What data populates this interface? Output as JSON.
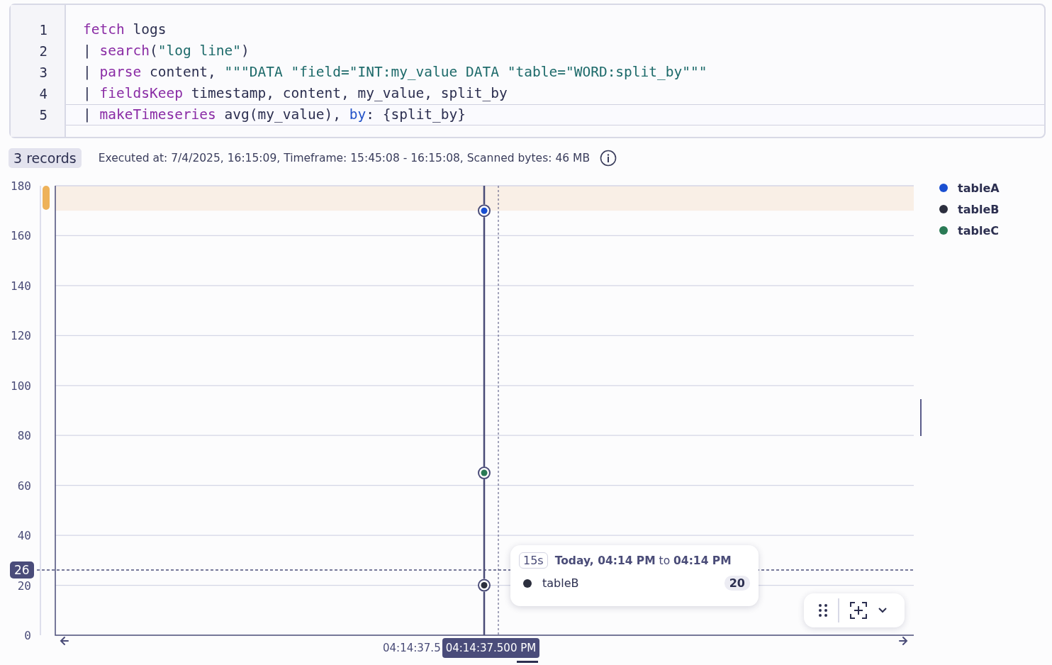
{
  "editor": {
    "lines": [
      {
        "number": "1",
        "current": false,
        "tokens": [
          {
            "kind": "kw",
            "text": "fetch"
          },
          {
            "kind": "plain",
            "text": " logs"
          }
        ]
      },
      {
        "number": "2",
        "current": false,
        "tokens": [
          {
            "kind": "plain",
            "text": "| "
          },
          {
            "kind": "kw",
            "text": "search"
          },
          {
            "kind": "plain",
            "text": "("
          },
          {
            "kind": "str",
            "text": "\"log line\""
          },
          {
            "kind": "plain",
            "text": ")"
          }
        ]
      },
      {
        "number": "3",
        "current": false,
        "tokens": [
          {
            "kind": "plain",
            "text": "| "
          },
          {
            "kind": "kw",
            "text": "parse"
          },
          {
            "kind": "plain",
            "text": " content, "
          },
          {
            "kind": "str",
            "text": "\"\"\"DATA \"field=\"INT:my_value DATA \"table=\"WORD:split_by\"\"\""
          }
        ]
      },
      {
        "number": "4",
        "current": false,
        "tokens": [
          {
            "kind": "plain",
            "text": "| "
          },
          {
            "kind": "kw",
            "text": "fieldsKeep"
          },
          {
            "kind": "plain",
            "text": " timestamp, content, my_value, split_by"
          }
        ]
      },
      {
        "number": "5",
        "current": true,
        "tokens": [
          {
            "kind": "plain",
            "text": "| "
          },
          {
            "kind": "kw",
            "text": "makeTimeseries"
          },
          {
            "kind": "plain",
            "text": " avg(my_value), "
          },
          {
            "kind": "param",
            "text": "by"
          },
          {
            "kind": "plain",
            "text": ": {split_by}"
          }
        ]
      }
    ]
  },
  "status": {
    "records": "3 records",
    "info": "Executed at: 7/4/2025, 16:15:09, Timeframe: 15:45:08 - 16:15:08, Scanned bytes: 46 MB"
  },
  "chart": {
    "chart_data": {
      "type": "line",
      "x": [
        "04:14:37.5"
      ],
      "ylim": [
        0,
        180
      ],
      "yticks": [
        0,
        20,
        40,
        60,
        80,
        100,
        120,
        140,
        160,
        180
      ],
      "grid": true,
      "legend": true,
      "bands": [
        {
          "axis": "y",
          "from": 170,
          "to": 180,
          "color": "#f9efe6"
        }
      ],
      "series": [
        {
          "name": "tableA",
          "color": "#1a4fd1",
          "marker": "circle",
          "values": [
            170
          ]
        },
        {
          "name": "tableB",
          "color": "#2c2f3e",
          "marker": "circle",
          "values": [
            20
          ]
        },
        {
          "name": "tableC",
          "color": "#2a7a55",
          "marker": "circle",
          "values": [
            65
          ]
        }
      ]
    },
    "crosshair": {
      "value_badge": "26",
      "time_badge": "04:14:37.500 PM"
    },
    "tooltip": {
      "interval": "15s",
      "range": "**Today, 04:14 PM** to **04:14 PM**",
      "series": "tableB",
      "color": "#2c2f3e",
      "value": "20"
    }
  }
}
